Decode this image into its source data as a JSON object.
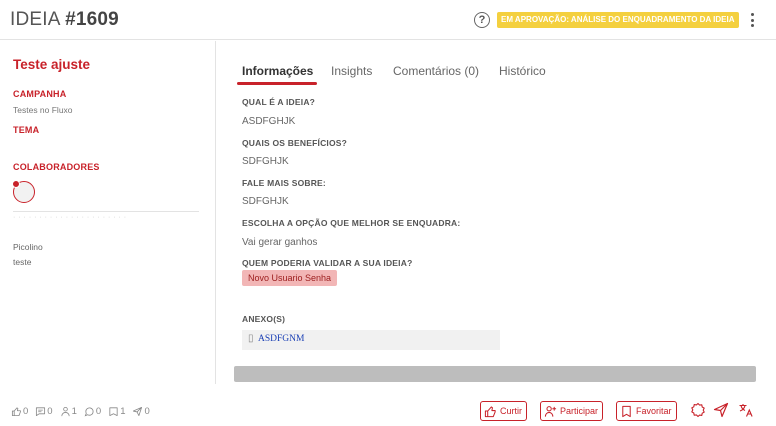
{
  "header": {
    "title_prefix": "IDEIA ",
    "title_number": "#1609",
    "help_symbol": "?",
    "status": "EM APROVAÇÃO: ANÁLISE DO ENQUADRAMENTO DA IDEIA",
    "status_color": "#f4d03f"
  },
  "sidebar": {
    "idea_name": "Teste ajuste",
    "campaign_label": "CAMPANHA",
    "campaign_value": "Testes no Fluxo",
    "theme_label": "TEMA",
    "collaborators_label": "COLABORADORES",
    "author_name": "Picolino",
    "author_subtitle": "teste"
  },
  "tabs": [
    {
      "label": "Informações",
      "active": true
    },
    {
      "label": "Insights",
      "active": false
    },
    {
      "label": "Comentários (0)",
      "active": false
    },
    {
      "label": "Histórico",
      "active": false
    }
  ],
  "info": {
    "q1_label": "QUAL É A IDEIA?",
    "q1_value": "ASDFGHJK",
    "q2_label": "QUAIS OS BENEFÍCIOS?",
    "q2_value": "SDFGHJK",
    "q3_label": "FALE MAIS SOBRE:",
    "q3_value": "SDFGHJK",
    "q4_label": "ESCOLHA A OPÇÃO QUE MELHOR SE ENQUADRA:",
    "q4_value": "Vai gerar ganhos",
    "q5_label": "QUEM PODERIA VALIDAR A SUA IDEIA?",
    "q5_value": "Novo Usuario Senha",
    "attachments_label": "ANEXO(S)",
    "attachment_name": "ASDFGNM"
  },
  "stats": [
    {
      "icon": "thumbs-up-icon",
      "value": "0"
    },
    {
      "icon": "comment-icon",
      "value": "0"
    },
    {
      "icon": "participants-icon",
      "value": "1"
    },
    {
      "icon": "insight-icon",
      "value": "0"
    },
    {
      "icon": "bookmark-icon",
      "value": "1"
    },
    {
      "icon": "share-icon",
      "value": "0"
    }
  ],
  "actions": {
    "like": "Curtir",
    "participate": "Participar",
    "favorite": "Favoritar"
  },
  "colors": {
    "accent": "#c8222a",
    "tag_bg": "#f2b6b6"
  }
}
